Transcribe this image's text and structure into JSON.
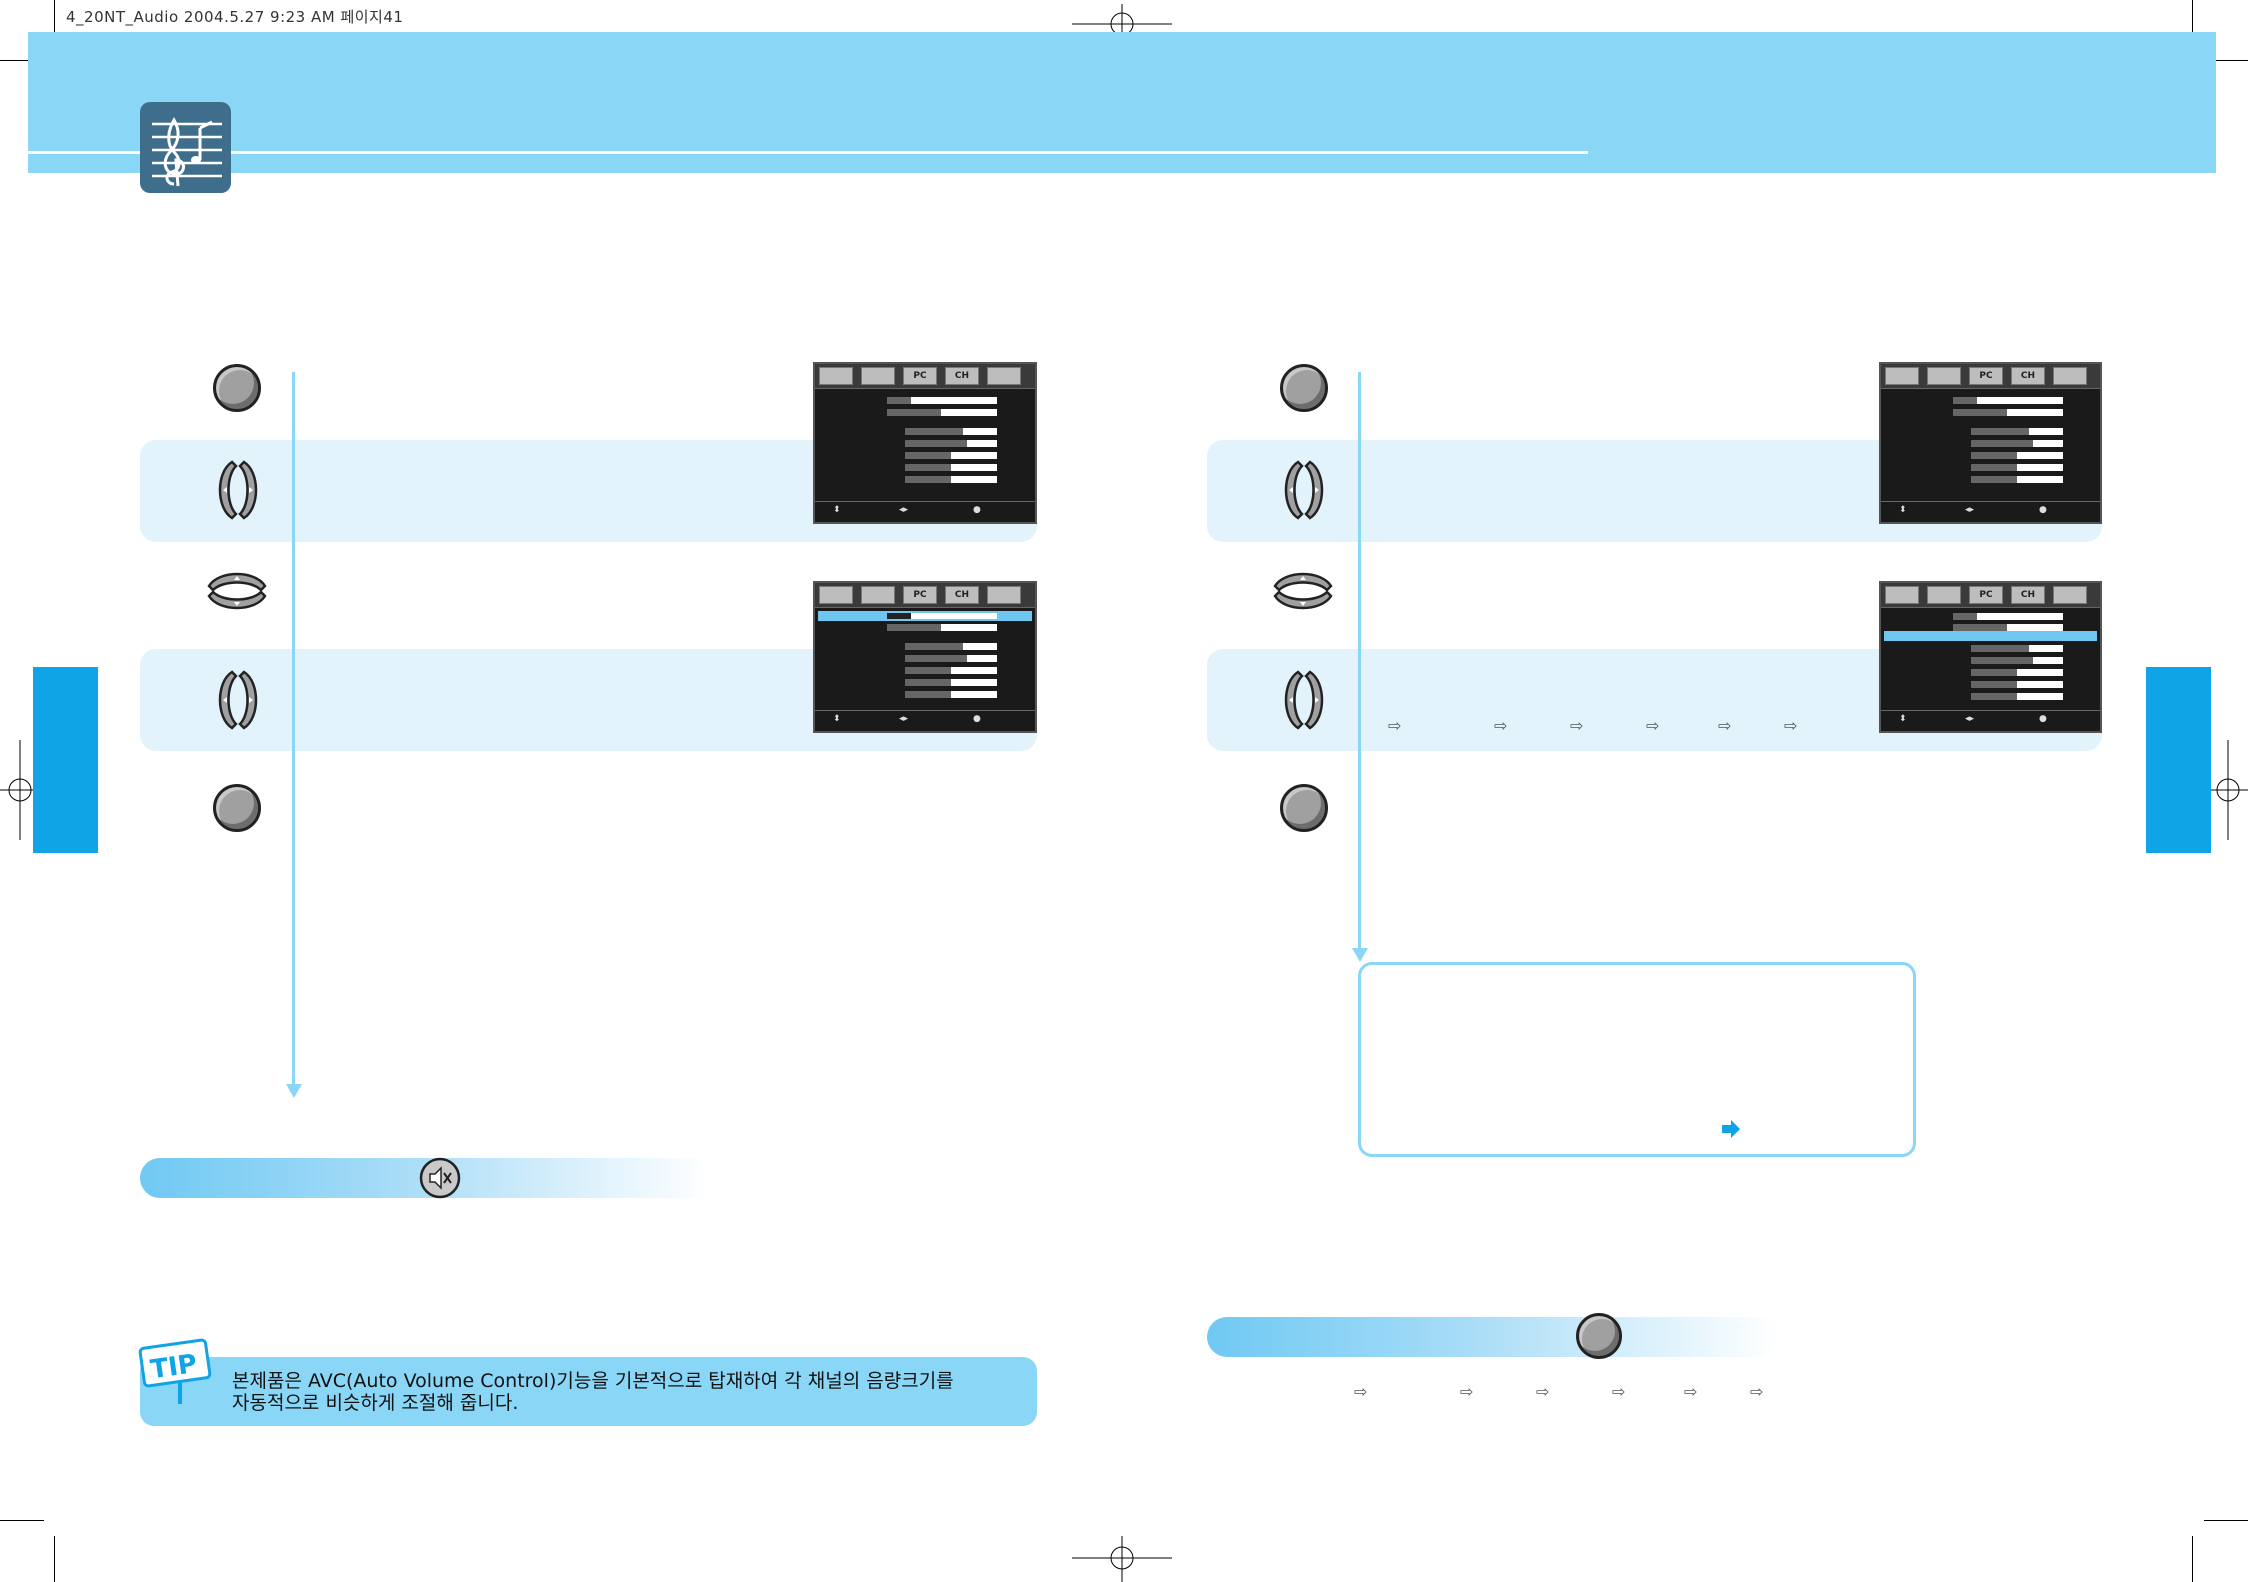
{
  "print_slug": "4_20NT_Audio  2004.5.27 9:23 AM 페이지41",
  "tip": {
    "badge": "TIP",
    "text_line1": "본제품은 AVC(Auto Volume Control)기능을 기본적으로 탑재하여 각 채널의 음량크기를",
    "text_line2": "자동적으로 비슷하게 조절해 줍니다."
  },
  "osd_tabs": [
    "",
    "",
    "PC",
    "CH",
    ""
  ],
  "colors": {
    "header": "#8ad6f6",
    "side_tab": "#0fa4e5",
    "step_band": "#e3f3fc",
    "note_arrow": "#0fa4e5"
  },
  "icons": {
    "header": "music-note-icon",
    "mute": "mute-speaker-icon",
    "sequence": "arrow-right-icon",
    "note": "blue-arrow-icon"
  }
}
